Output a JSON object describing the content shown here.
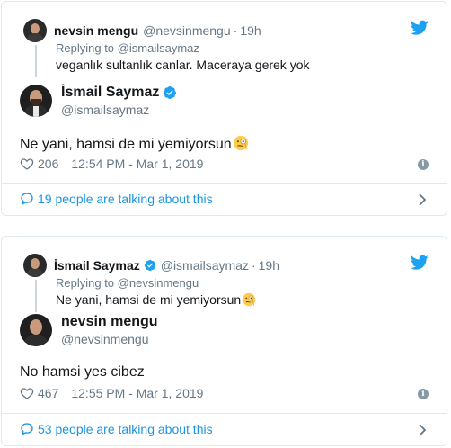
{
  "tweets": [
    {
      "parent": {
        "name": "nevsin mengu",
        "handle": "@nevsinmengu",
        "dot": "·",
        "time": "19h",
        "replying_label": "Replying to",
        "replying_to": "@ismailsaymaz",
        "text": "veganlık sultanlık canlar. Maceraya gerek yok"
      },
      "main": {
        "name": "İsmail Saymaz",
        "handle": "@ismailsaymaz",
        "verified": true,
        "text": "Ne yani, hamsi de mi yemiyorsun",
        "emoji": "face-with-monocle",
        "likes": "206",
        "timestamp": "12:54 PM - Mar 1, 2019",
        "talking": "19 people are talking about this"
      }
    },
    {
      "parent": {
        "name": "İsmail Saymaz",
        "handle": "@ismailsaymaz",
        "dot": "·",
        "time": "19h",
        "verified": true,
        "replying_label": "Replying to",
        "replying_to": "@nevsinmengu",
        "text": "Ne yani, hamsi de mi yemiyorsun",
        "emoji": "face-with-monocle"
      },
      "main": {
        "name": "nevsin mengu",
        "handle": "@nevsinmengu",
        "verified": false,
        "text": "No hamsi yes cibez",
        "likes": "467",
        "timestamp": "12:55 PM - Mar 1, 2019",
        "talking": "53 people are talking about this"
      }
    }
  ],
  "colors": {
    "twitter_blue": "#1da1f2",
    "link_blue": "#1b95e0",
    "muted_gray": "#657786",
    "border": "#e1e8ed"
  },
  "icons": [
    "twitter-bird-icon",
    "verified-icon",
    "heart-icon",
    "info-icon",
    "speech-bubble-icon",
    "chevron-right-icon"
  ]
}
